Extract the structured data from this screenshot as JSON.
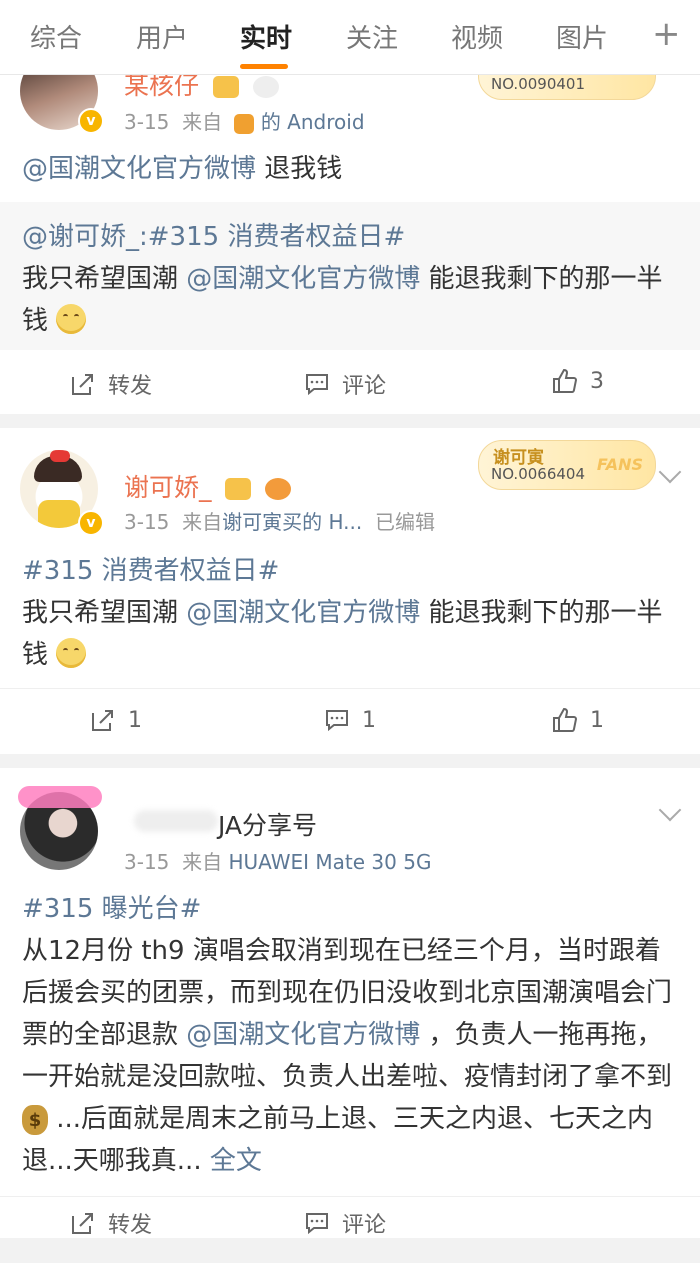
{
  "tabs": [
    "综合",
    "用户",
    "实时",
    "关注",
    "视频",
    "图片"
  ],
  "plus": "+",
  "card1": {
    "username": "某核仔",
    "fans_no": "NO.0090401",
    "meta_date": "3-15",
    "meta_from": "来自",
    "meta_source": "的 Android",
    "body_mention": "@国潮文化官方微博",
    "body_text": " 退我钱",
    "quote_user": "@谢可娇_:",
    "quote_topic": "#315 消费者权益日#",
    "quote_text_1": "我只希望国潮 ",
    "quote_mention": "@国潮文化官方微博",
    "quote_text_2": " 能退我剩下的那一半钱",
    "forward_label": "转发",
    "comment_label": "评论",
    "like_count": "3"
  },
  "card2": {
    "username": "谢可娇_",
    "fans_name": "谢可寅",
    "fans_no": "NO.0066404",
    "fans_tag": "FANS",
    "meta_date": "3-15",
    "meta_from": "来自",
    "meta_source": "谢可寅买的 H...",
    "meta_edited": "已编辑",
    "topic": "#315 消费者权益日#",
    "text_1": "我只希望国潮 ",
    "mention": "@国潮文化官方微博",
    "text_2": " 能退我剩下的那一半钱",
    "forward_count": "1",
    "comment_count": "1",
    "like_count": "1"
  },
  "card3": {
    "username": "JA分享号",
    "meta_date": "3-15",
    "meta_from": "来自",
    "meta_source": "HUAWEI Mate 30 5G",
    "topic": "#315 曝光台#",
    "text_1": "从12月份 th9 演唱会取消到现在已经三个月，当时跟着后援会买的团票，而到现在仍旧没收到北京国潮演唱会门票的全部退款 ",
    "mention": "@国潮文化官方微博",
    "text_2": " ，负责人一拖再拖，一开始就是没回款啦、负责人出差啦、疫情封闭了拿不到",
    "text_3": "...后面就是周末之前马上退、三天之内退、七天之内退...天哪我真...",
    "full_text": "全文",
    "forward_label": "转发",
    "comment_label": "评论"
  }
}
